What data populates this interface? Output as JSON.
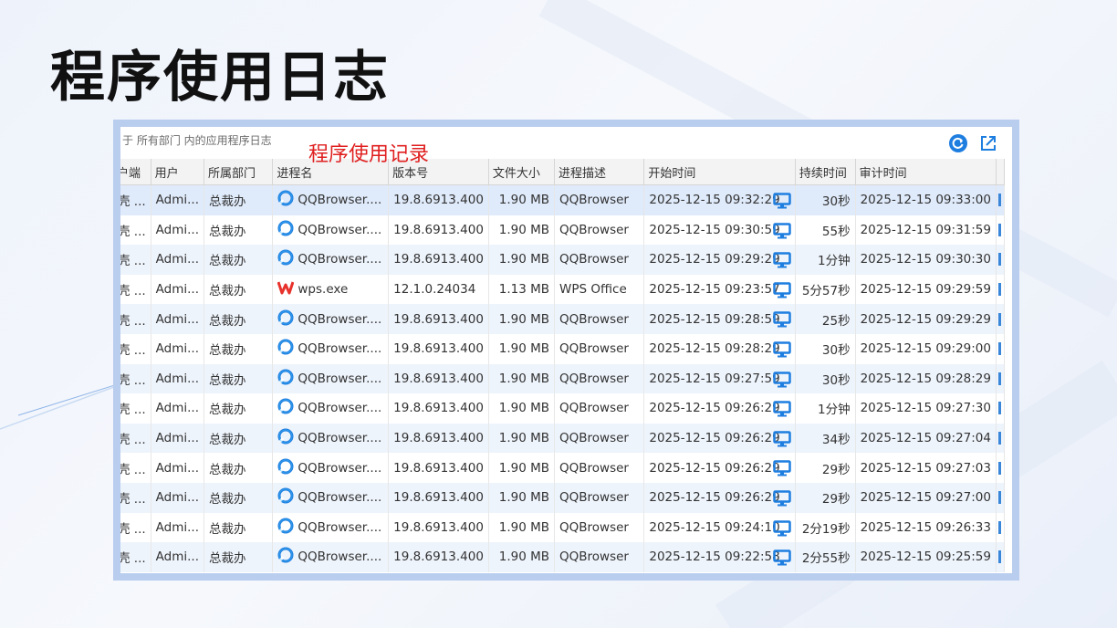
{
  "slide": {
    "title": "程序使用日志"
  },
  "window": {
    "scope_text": "于 所有部门 内的应用程序日志",
    "annotation": "程序使用记录"
  },
  "columns": [
    "户端",
    "用户",
    "所属部门",
    "进程名",
    "版本号",
    "文件大小",
    "进程描述",
    "开始时间",
    "持续时间",
    "审计时间"
  ],
  "rows": [
    {
      "client": "壳 ...",
      "user": "Admi...",
      "dept": "总裁办",
      "process": "QQBrowser....",
      "icon": "qqbrowser-icon",
      "version": "19.8.6913.400",
      "size": "1.90 MB",
      "desc": "QQBrowser",
      "start": "2025-12-15 09:32:29",
      "duration": "30秒",
      "audit": "2025-12-15 09:33:00"
    },
    {
      "client": "壳 ...",
      "user": "Admi...",
      "dept": "总裁办",
      "process": "QQBrowser....",
      "icon": "qqbrowser-icon",
      "version": "19.8.6913.400",
      "size": "1.90 MB",
      "desc": "QQBrowser",
      "start": "2025-12-15 09:30:59",
      "duration": "55秒",
      "audit": "2025-12-15 09:31:59"
    },
    {
      "client": "壳 ...",
      "user": "Admi...",
      "dept": "总裁办",
      "process": "QQBrowser....",
      "icon": "qqbrowser-icon",
      "version": "19.8.6913.400",
      "size": "1.90 MB",
      "desc": "QQBrowser",
      "start": "2025-12-15 09:29:29",
      "duration": "1分钟",
      "audit": "2025-12-15 09:30:30"
    },
    {
      "client": "壳 ...",
      "user": "Admi...",
      "dept": "总裁办",
      "process": "wps.exe",
      "icon": "wps-icon",
      "version": "12.1.0.24034",
      "size": "1.13 MB",
      "desc": "WPS Office",
      "start": "2025-12-15 09:23:57",
      "duration": "5分57秒",
      "audit": "2025-12-15 09:29:59"
    },
    {
      "client": "壳 ...",
      "user": "Admi...",
      "dept": "总裁办",
      "process": "QQBrowser....",
      "icon": "qqbrowser-icon",
      "version": "19.8.6913.400",
      "size": "1.90 MB",
      "desc": "QQBrowser",
      "start": "2025-12-15 09:28:59",
      "duration": "25秒",
      "audit": "2025-12-15 09:29:29"
    },
    {
      "client": "壳 ...",
      "user": "Admi...",
      "dept": "总裁办",
      "process": "QQBrowser....",
      "icon": "qqbrowser-icon",
      "version": "19.8.6913.400",
      "size": "1.90 MB",
      "desc": "QQBrowser",
      "start": "2025-12-15 09:28:29",
      "duration": "30秒",
      "audit": "2025-12-15 09:29:00"
    },
    {
      "client": "壳 ...",
      "user": "Admi...",
      "dept": "总裁办",
      "process": "QQBrowser....",
      "icon": "qqbrowser-icon",
      "version": "19.8.6913.400",
      "size": "1.90 MB",
      "desc": "QQBrowser",
      "start": "2025-12-15 09:27:59",
      "duration": "30秒",
      "audit": "2025-12-15 09:28:29"
    },
    {
      "client": "壳 ...",
      "user": "Admi...",
      "dept": "总裁办",
      "process": "QQBrowser....",
      "icon": "qqbrowser-icon",
      "version": "19.8.6913.400",
      "size": "1.90 MB",
      "desc": "QQBrowser",
      "start": "2025-12-15 09:26:29",
      "duration": "1分钟",
      "audit": "2025-12-15 09:27:30"
    },
    {
      "client": "壳 ...",
      "user": "Admi...",
      "dept": "总裁办",
      "process": "QQBrowser....",
      "icon": "qqbrowser-icon",
      "version": "19.8.6913.400",
      "size": "1.90 MB",
      "desc": "QQBrowser",
      "start": "2025-12-15 09:26:29",
      "duration": "34秒",
      "audit": "2025-12-15 09:27:04"
    },
    {
      "client": "壳 ...",
      "user": "Admi...",
      "dept": "总裁办",
      "process": "QQBrowser....",
      "icon": "qqbrowser-icon",
      "version": "19.8.6913.400",
      "size": "1.90 MB",
      "desc": "QQBrowser",
      "start": "2025-12-15 09:26:29",
      "duration": "29秒",
      "audit": "2025-12-15 09:27:03"
    },
    {
      "client": "壳 ...",
      "user": "Admi...",
      "dept": "总裁办",
      "process": "QQBrowser....",
      "icon": "qqbrowser-icon",
      "version": "19.8.6913.400",
      "size": "1.90 MB",
      "desc": "QQBrowser",
      "start": "2025-12-15 09:26:29",
      "duration": "29秒",
      "audit": "2025-12-15 09:27:00"
    },
    {
      "client": "壳 ...",
      "user": "Admi...",
      "dept": "总裁办",
      "process": "QQBrowser....",
      "icon": "qqbrowser-icon",
      "version": "19.8.6913.400",
      "size": "1.90 MB",
      "desc": "QQBrowser",
      "start": "2025-12-15 09:24:10",
      "duration": "2分19秒",
      "audit": "2025-12-15 09:26:33"
    },
    {
      "client": "壳 ...",
      "user": "Admi...",
      "dept": "总裁办",
      "process": "QQBrowser....",
      "icon": "qqbrowser-icon",
      "version": "19.8.6913.400",
      "size": "1.90 MB",
      "desc": "QQBrowser",
      "start": "2025-12-15 09:22:58",
      "duration": "2分55秒",
      "audit": "2025-12-15 09:25:59"
    }
  ],
  "colors": {
    "accent": "#1e7ee0",
    "annotation": "#e02020",
    "frame": "#b9cdee",
    "wps": "#e8322c"
  }
}
